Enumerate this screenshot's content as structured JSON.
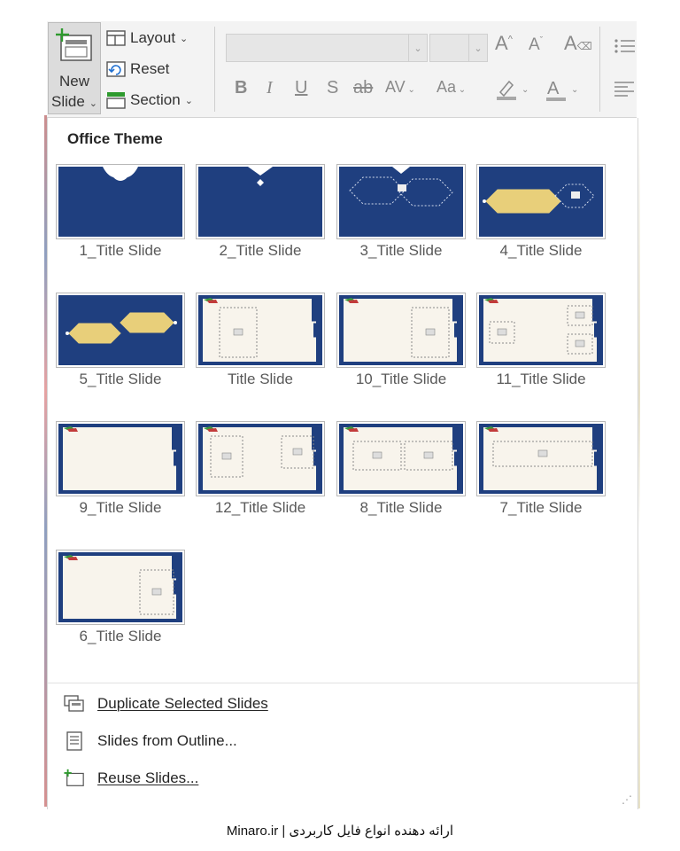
{
  "ribbon": {
    "new_slide_line1": "New",
    "new_slide_line2": "Slide",
    "new_slide_chevron": "⌄",
    "layout_label": "Layout",
    "reset_label": "Reset",
    "section_label": "Section",
    "font_name_value": "",
    "font_size_value": "",
    "increase_font": "A",
    "decrease_font": "A",
    "bold": "B",
    "italic": "I",
    "underline": "U",
    "shadow": "S",
    "strikethrough": "ab",
    "char_spacing": "AV",
    "change_case": "Aa",
    "font_color": "A"
  },
  "gallery": {
    "section_title": "Office Theme",
    "layouts": [
      {
        "label": "1_Title Slide",
        "style": "full-blue-notch"
      },
      {
        "label": "2_Title Slide",
        "style": "full-blue-notch-small"
      },
      {
        "label": "3_Title Slide",
        "style": "blue-hexagons"
      },
      {
        "label": "4_Title Slide",
        "style": "blue-gold-hex"
      },
      {
        "label": "5_Title Slide",
        "style": "blue-two-gold-hex"
      },
      {
        "label": "Title Slide",
        "style": "cream-left-box"
      },
      {
        "label": "10_Title Slide",
        "style": "cream-right-box"
      },
      {
        "label": "11_Title Slide",
        "style": "cream-three-boxes"
      },
      {
        "label": "9_Title Slide",
        "style": "cream-empty"
      },
      {
        "label": "12_Title Slide",
        "style": "cream-two-boxes"
      },
      {
        "label": "8_Title Slide",
        "style": "cream-two-wide"
      },
      {
        "label": "7_Title Slide",
        "style": "cream-wide"
      },
      {
        "label": "6_Title Slide",
        "style": "cream-right-tall"
      }
    ]
  },
  "menu": {
    "duplicate": "Duplicate Selected Slides",
    "outline": "Slides from Outline...",
    "reuse": "Reuse Slides..."
  },
  "footer": {
    "text": "Minaro.ir | ارائه دهنده انواع فایل کاربردی"
  },
  "colors": {
    "slide_blue": "#1f3f7f",
    "gold": "#e8cf7a",
    "cream": "#f8f4ec",
    "green_accent": "#3a9a3a"
  }
}
